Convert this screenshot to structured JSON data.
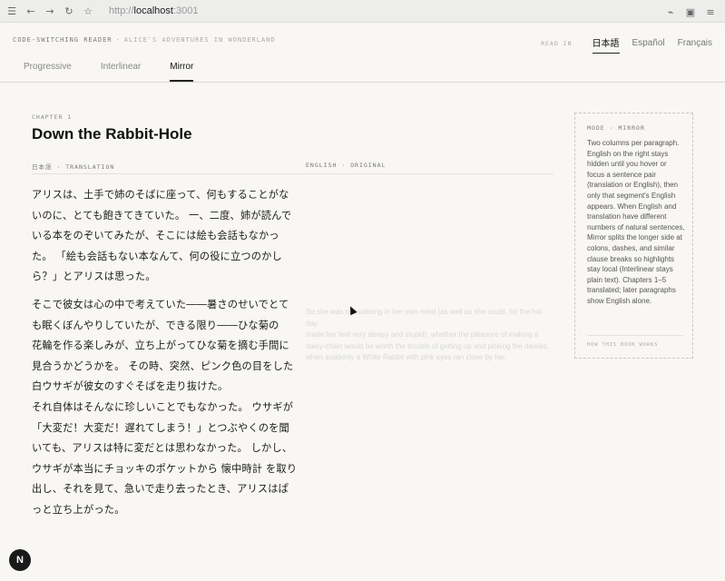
{
  "browser": {
    "url_scheme": "http://",
    "url_host": "localhost",
    "url_port": ":3001",
    "icons": [
      "sidebar-icon",
      "back-icon",
      "forward-icon",
      "reload-icon",
      "star-icon",
      "extension-icon",
      "screenshot-icon",
      "menu-icon"
    ]
  },
  "header": {
    "brand": "CODE-SWITCHING READER",
    "separator": "·",
    "book": "ALICE'S ADVENTURES IN WONDERLAND",
    "read_in_label": "READ IN",
    "languages": [
      "日本語",
      "Español",
      "Français"
    ],
    "active_language": "日本語"
  },
  "tabs": [
    "Progressive",
    "Interlinear",
    "Mirror"
  ],
  "active_tab": "Mirror",
  "chapter": {
    "label": "CHAPTER 1",
    "title": "Down the Rabbit-Hole"
  },
  "columns": {
    "left": "日本語 · TRANSLATION",
    "right": "ENGLISH · ORIGINAL"
  },
  "paragraphs_jp": [
    [
      "アリスは、土手で姉のそばに座って、何もすることがな",
      "いのに、とても飽きてきていた。 一、二度、姉が読んで",
      "いる本をのぞいてみたが、そこには絵も会話もなかっ",
      "た。 「絵も会話もない本なんて、何の役に立つのかし",
      "ら？」とアリスは思った。"
    ],
    [
      "そこで彼女は心の中で考えていた――暑さのせいでとて",
      "も眠くぼんやりしていたが、できる限り――ひな菊の",
      "花輪を作る楽しみが、立ち上がってひな菊を摘む手間に",
      "見合うかどうかを。 その時、突然、ピンク色の目をした",
      "白ウサギが彼女のすぐそばを走り抜けた。"
    ],
    [
      "それ自体はそんなに珍しいことでもなかった。 ウサギが",
      "「大変だ！大変だ！遅れてしまう！」とつぶやくのを聞",
      "いても、アリスは特に変だとは思わなかった。 しかし、",
      "ウサギが本当にチョッキのポケットから 懐中時計 を取り",
      "出し、それを見て、急いで走り去ったとき、アリスはぱ",
      "っと立ち上がった。"
    ]
  ],
  "english_faint": [
    "So she was considering in her own mind (as well as she could, for the hot day",
    "made her feel very sleepy and stupid), whether the pleasure of making a",
    "daisy-chain would be worth the trouble of getting up and picking the daisies,",
    "when suddenly a White Rabbit with pink eyes ran close by her."
  ],
  "side_panel": {
    "head": "MODE · MIRROR",
    "body": "Two columns per paragraph. English on the right stays hidden until you hover or focus a sentence pair (translation or English), then only that segment's English appears. When English and translation have different numbers of natural sentences, Mirror splits the longer side at colons, dashes, and similar clause breaks so highlights stay local (Interlinear stays plain text). Chapters 1–5 translated; later paragraphs show English alone.",
    "footer": "HOW THIS BOOK WORKS"
  },
  "badge": "N"
}
